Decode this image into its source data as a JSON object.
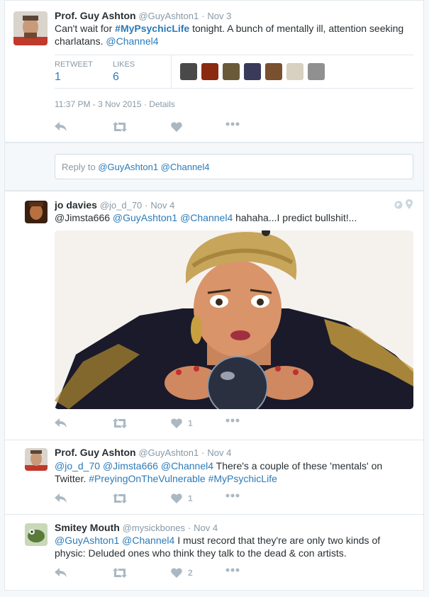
{
  "main_tweet": {
    "name": "Prof. Guy Ashton",
    "handle": "@GuyAshton1",
    "date": "Nov 3",
    "text_pre": "Can't wait for ",
    "hashtag": "#MyPsychicLife",
    "text_mid": " tonight. A bunch of mentally ill, attention seeking charlatans. ",
    "mention": "@Channel4",
    "retweet_label": "RETWEET",
    "retweet_count": "1",
    "likes_label": "LIKES",
    "likes_count": "6",
    "timestamp": "11:37 PM - 3 Nov 2015",
    "details_label": "Details",
    "liker_colors": [
      "#4a4a4a",
      "#8a2a10",
      "#6b5a3a",
      "#3a3a5a",
      "#7a5030",
      "#d8d0c0",
      "#909090"
    ]
  },
  "reply_box": {
    "prefix": "Reply to ",
    "mentions": "@GuyAshton1 @Channel4"
  },
  "replies": [
    {
      "name": "jo davies",
      "handle": "@jo_d_70",
      "date": "Nov 4",
      "m1": "@Jimsta666",
      "m2": "@GuyAshton1",
      "m3": "@Channel4",
      "text": " hahaha...I predict bullshit!...",
      "like_count": "1"
    },
    {
      "name": "Prof. Guy Ashton",
      "handle": "@GuyAshton1",
      "date": "Nov 4",
      "m1": "@jo_d_70",
      "m2": "@Jimsta666",
      "m3": "@Channel4",
      "text": " There's a couple of these 'mentals' on Twitter. ",
      "h1": "#PreyingOnTheVulnerable",
      "h2": "#MyPsychicLife",
      "like_count": "1"
    },
    {
      "name": "Smitey Mouth",
      "handle": "@mysickbones",
      "date": "Nov 4",
      "m1": "@GuyAshton1",
      "m2": "@Channel4",
      "text": "  I must record that they're are only two kinds of physic: Deluded ones who think they talk to the dead &  con artists.",
      "like_count": "2"
    }
  ],
  "separator": "·",
  "colors": {
    "link": "#2b7bb9",
    "muted": "#8899a6",
    "icon": "#aab8c2",
    "border": "#e1e8ed"
  }
}
